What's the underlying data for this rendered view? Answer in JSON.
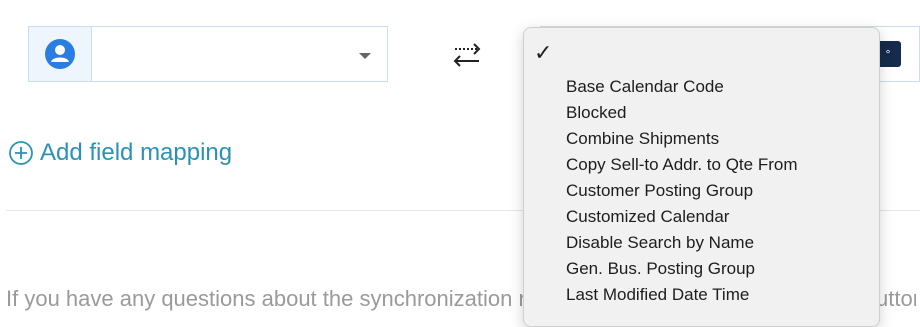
{
  "left_field": {
    "icon": "user-icon",
    "value": "",
    "caret_icon": "chevron-down-icon"
  },
  "swap_icon": "swap-arrows-icon",
  "right_field": {
    "mini_button_text": "°"
  },
  "add_mapping": {
    "icon": "add-circle-icon",
    "label": "Add field mapping"
  },
  "footer": {
    "text_left": "If you have any questions about the synchronization n",
    "text_right": "uttor"
  },
  "dropdown": {
    "checkmark": "✓",
    "items": [
      "Base Calendar Code",
      "Blocked",
      "Combine Shipments",
      "Copy Sell-to Addr. to Qte From",
      "Customer Posting Group",
      "Customized Calendar",
      "Disable Search by Name",
      "Gen. Bus. Posting Group",
      "Last Modified Date Time"
    ]
  },
  "colors": {
    "accent": "#2a93b4",
    "icon_blue": "#2a7de1",
    "field_border": "#c9dfee",
    "menu_bg": "#f1f1f1",
    "dark_button": "#152b4d"
  }
}
